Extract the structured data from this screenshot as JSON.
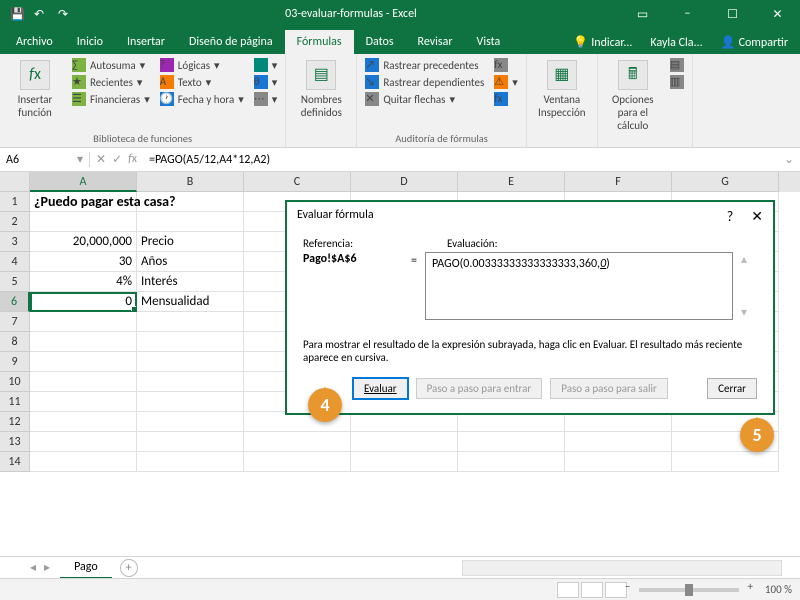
{
  "title": "03-evaluar-formulas - Excel",
  "tabs": {
    "archivo": "Archivo",
    "inicio": "Inicio",
    "insertar": "Insertar",
    "diseno": "Diseño de página",
    "formulas": "Fórmulas",
    "datos": "Datos",
    "revisar": "Revisar",
    "vista": "Vista"
  },
  "titleright": {
    "tell": "Indicar...",
    "user": "Kayla Cla...",
    "share": "Compartir"
  },
  "ribbon": {
    "insert_fn": "Insertar función",
    "lib": {
      "auto": "Autosuma",
      "recent": "Recientes",
      "fin": "Financieras",
      "logic": "Lógicas",
      "text": "Texto",
      "date": "Fecha y hora",
      "label": "Biblioteca de funciones"
    },
    "names": "Nombres definidos",
    "audit": {
      "prec": "Rastrear precedentes",
      "dep": "Rastrear dependientes",
      "rem": "Quitar flechas",
      "label": "Auditoría de fórmulas"
    },
    "watch": "Ventana Inspección",
    "calc": "Opciones para el cálculo"
  },
  "namebox": "A6",
  "formula": "=PAGO(A5/12,A4*12,A2)",
  "cells": {
    "a1": "¿Puedo pagar esta casa?",
    "a3": "20,000,000",
    "b3": "Precio",
    "a4": "30",
    "b4": "Años",
    "a5": "4%",
    "b5": "Interés",
    "a6": "0",
    "b6": "Mensualidad"
  },
  "sheet": "Pago",
  "zoom": "100 %",
  "dialog": {
    "title": "Evaluar fórmula",
    "ref_label": "Referencia:",
    "eval_label": "Evaluación:",
    "ref": "Pago!$A$6",
    "eval_pre": "PAGO(0.00333333333333333,360,",
    "eval_ul": "0",
    "eval_post": ")",
    "hint": "Para mostrar el resultado de la expresión subrayada, haga clic en Evaluar. El resultado más reciente aparece en cursiva.",
    "btn_eval": "Evaluar",
    "btn_in": "Paso a paso para entrar",
    "btn_out": "Paso a paso para salir",
    "btn_close": "Cerrar"
  },
  "callouts": {
    "c4": "4",
    "c5": "5"
  }
}
